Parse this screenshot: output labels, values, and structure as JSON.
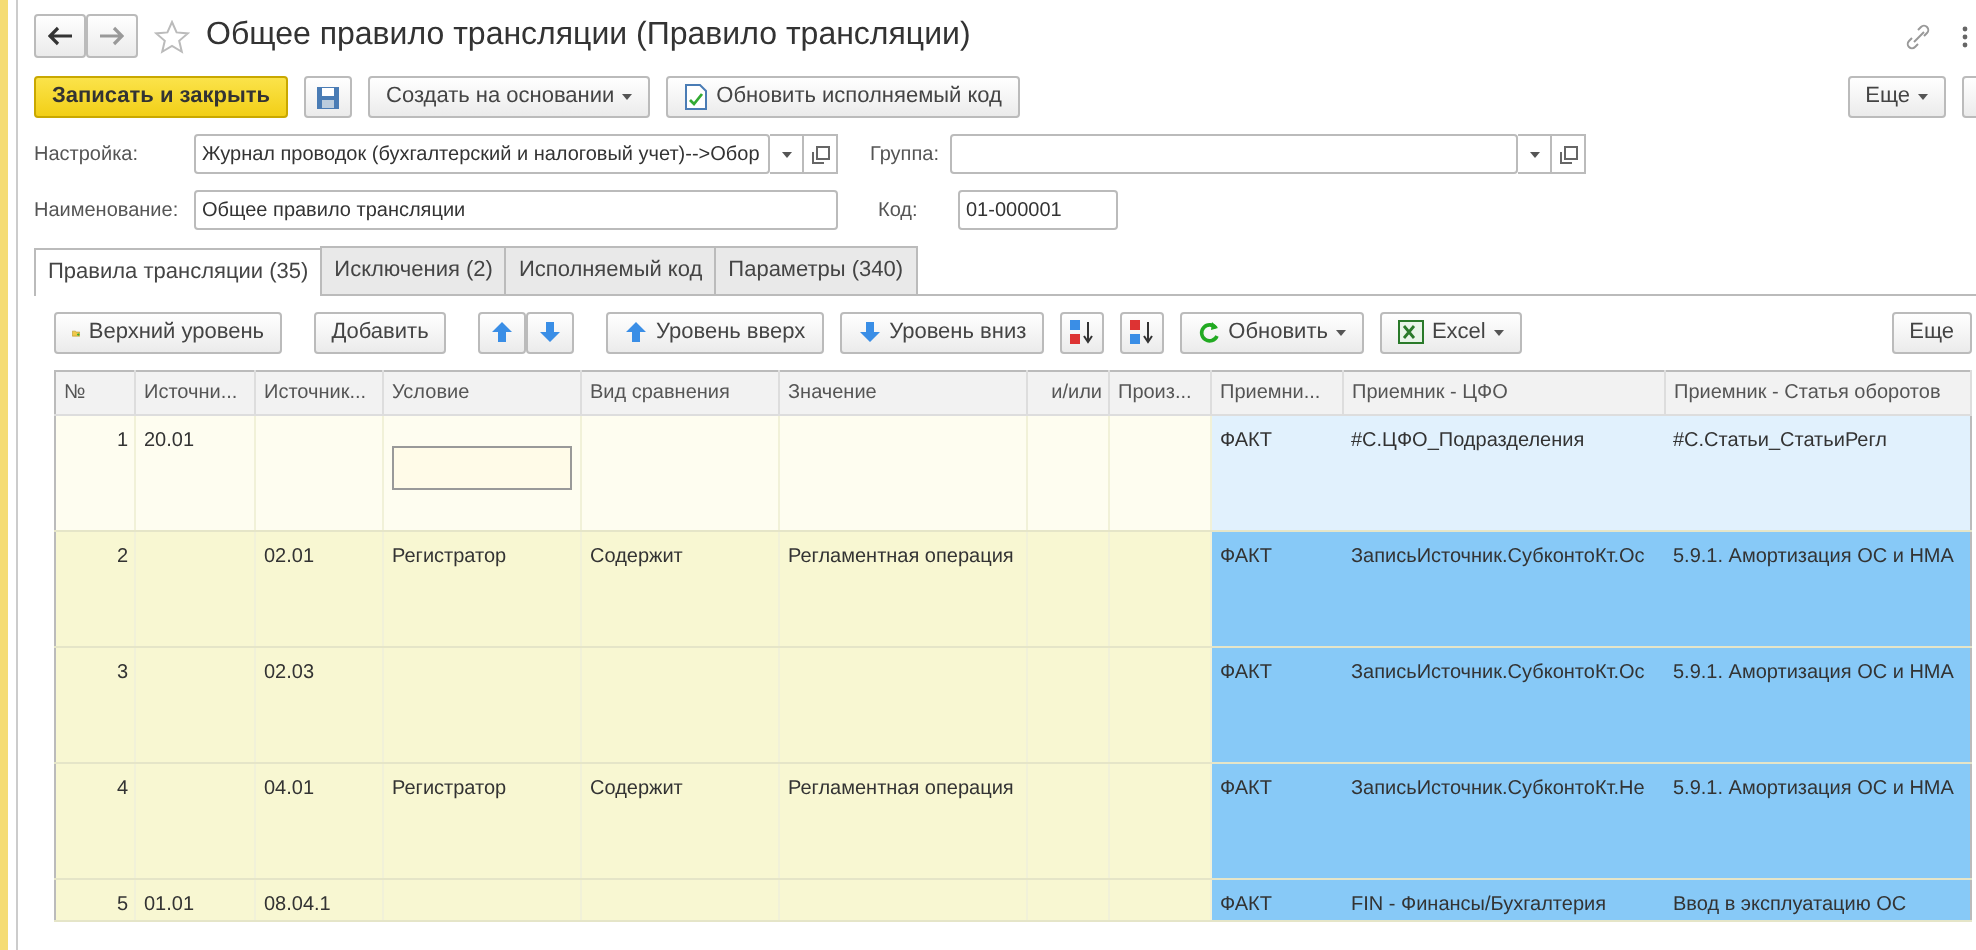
{
  "window": {
    "title": "Общее правило трансляции (Правило трансляции)"
  },
  "command_bar": [
    {
      "kind": "primary",
      "label": "Записать и закрыть"
    },
    {
      "kind": "save"
    },
    {
      "kind": "dropdown",
      "label": "Создать на основании"
    },
    {
      "kind": "code",
      "label": "Обновить исполняемый код"
    }
  ],
  "command_bar_right": [
    {
      "kind": "dropdown",
      "label": "Еще"
    },
    {
      "kind": "cut"
    }
  ],
  "fields": {
    "settings": {
      "label": "Настройка:",
      "value": "Журнал проводок (бухгалтерский и налоговый учет)-->Обор"
    },
    "group": {
      "label": "Группа:"
    },
    "name": {
      "label": "Наименование:",
      "value": "Общее правило трансляции"
    },
    "code": {
      "label": "Код:",
      "value": "01-000001"
    }
  },
  "tabs": [
    {
      "label": "Правила трансляции (35)",
      "selected": true
    },
    {
      "label": "Исключения (2)",
      "selected": false
    },
    {
      "label": "Исполняемый код",
      "selected": false
    },
    {
      "label": "Параметры (340)",
      "selected": false
    }
  ],
  "table_toolbar": [
    {
      "kind": "folder",
      "label": "Верхний уровень"
    },
    {
      "kind": "plain",
      "label": "Добавить"
    },
    {
      "kind": "updown"
    },
    {
      "kind": "levelup",
      "label": "Уровень вверх"
    },
    {
      "kind": "leveldown",
      "label": "Уровень вниз"
    },
    {
      "kind": "sortasc"
    },
    {
      "kind": "sortdesc"
    },
    {
      "kind": "refresh",
      "label": "Обновить"
    },
    {
      "kind": "excel",
      "label": "Excel"
    }
  ],
  "table_toolbar_right": {
    "label": "Еще"
  },
  "table": {
    "columns": [
      "№",
      "Источни...",
      "Источник...",
      "Условие",
      "Вид сравнения",
      "Значение",
      "и/или",
      "Произ...",
      "Приемни...",
      "Приемник - ЦФО",
      "Приемник - Статья оборотов"
    ],
    "rows": [
      {
        "selected": true,
        "cells": [
          "1",
          "20.01",
          null,
          null,
          null,
          null,
          null,
          null,
          "ФАКТ",
          "#С.ЦФО_Подразделения",
          "#С.Статьи_СтатьиРегл"
        ]
      },
      {
        "selected": false,
        "cells": [
          "2",
          null,
          "02.01",
          "Регистратор",
          "Содержит",
          "Регламентная операция",
          null,
          null,
          "ФАКТ",
          "ЗаписьИсточник.СубконтоКт.Ос",
          "5.9.1.  Амортизация ОС и НМА"
        ]
      },
      {
        "selected": false,
        "cells": [
          "3",
          null,
          "02.03",
          null,
          null,
          null,
          null,
          null,
          "ФАКТ",
          "ЗаписьИсточник.СубконтоКт.Ос",
          "5.9.1.  Амортизация ОС и НМА"
        ]
      },
      {
        "selected": false,
        "cells": [
          "4",
          null,
          "04.01",
          "Регистратор",
          "Содержит",
          "Регламентная операция",
          null,
          null,
          "ФАКТ",
          "ЗаписьИсточник.СубконтоКт.Не",
          "5.9.1.  Амортизация ОС и НМА"
        ]
      },
      {
        "selected": false,
        "cells": [
          "5",
          "01.01",
          "08.04.1",
          null,
          null,
          null,
          null,
          null,
          "ФАКТ",
          "FIN - Финансы/Бухгалтерия",
          "Ввод в эксплуатацию ОС"
        ]
      }
    ]
  }
}
